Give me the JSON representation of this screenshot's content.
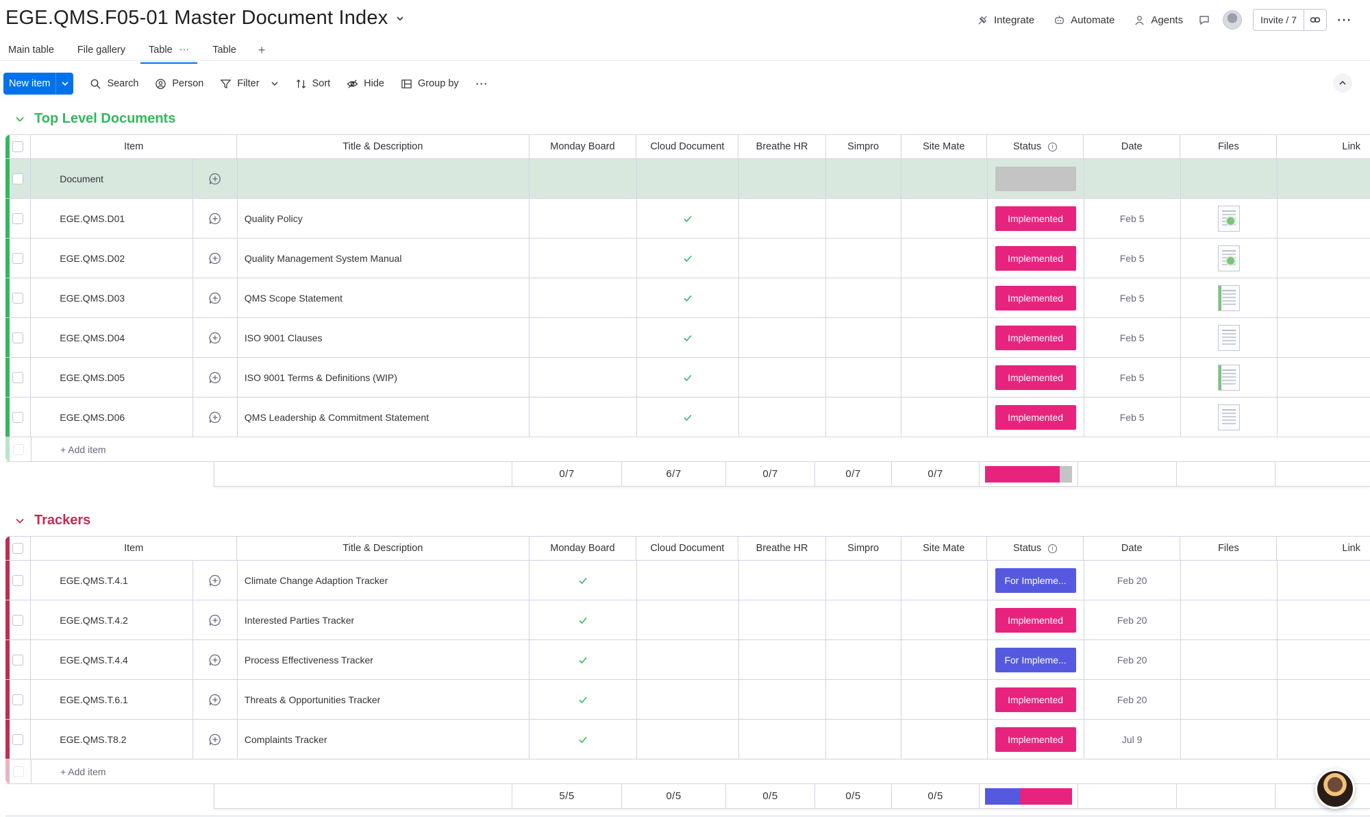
{
  "board": {
    "title": "EGE.QMS.F05-01 Master Document Index"
  },
  "top_actions": {
    "integrate": "Integrate",
    "automate": "Automate",
    "agents": "Agents",
    "invite": "Invite / 7"
  },
  "tabs": [
    {
      "label": "Main table"
    },
    {
      "label": "File gallery"
    },
    {
      "label": "Table",
      "active": true
    },
    {
      "label": "Table"
    }
  ],
  "toolbar": {
    "new_item": "New item",
    "search": "Search",
    "person": "Person",
    "filter": "Filter",
    "sort": "Sort",
    "hide": "Hide",
    "group_by": "Group by"
  },
  "columns": [
    "Item",
    "Title & Description",
    "Monday Board",
    "Cloud Document",
    "Breathe HR",
    "Simpro",
    "Site Mate",
    "Status",
    "Date",
    "Files",
    "Link"
  ],
  "colors": {
    "accent": "#0073ea",
    "group1": "#33b75d",
    "group2": "#c22c51",
    "implemented": "#e8237d",
    "for_implementation": "#5559df",
    "empty_status": "#c4c4c4",
    "check": "#33b75d",
    "selected_row": "#d9e8de"
  },
  "groups": [
    {
      "title": "Top Level Documents",
      "color": "#33b75d",
      "add_item": "+ Add item",
      "rows": [
        {
          "item": "Document",
          "title": "",
          "monday": false,
          "cloud": false,
          "status": "",
          "date": "",
          "file": ""
        },
        {
          "item": "EGE.QMS.D01",
          "title": "Quality Policy",
          "monday": false,
          "cloud": true,
          "status": "Implemented",
          "date": "Feb 5",
          "file": "green"
        },
        {
          "item": "EGE.QMS.D02",
          "title": "Quality Management System Manual",
          "monday": false,
          "cloud": true,
          "status": "Implemented",
          "date": "Feb 5",
          "file": "green"
        },
        {
          "item": "EGE.QMS.D03",
          "title": "QMS Scope Statement",
          "monday": false,
          "cloud": true,
          "status": "Implemented",
          "date": "Feb 5",
          "file": "side"
        },
        {
          "item": "EGE.QMS.D04",
          "title": "ISO 9001 Clauses",
          "monday": false,
          "cloud": true,
          "status": "Implemented",
          "date": "Feb 5",
          "file": "plain"
        },
        {
          "item": "EGE.QMS.D05",
          "title": "ISO 9001 Terms & Definitions (WIP)",
          "monday": false,
          "cloud": true,
          "status": "Implemented",
          "date": "Feb 5",
          "file": "side"
        },
        {
          "item": "EGE.QMS.D06",
          "title": "QMS Leadership & Commitment Statement",
          "monday": false,
          "cloud": true,
          "status": "Implemented",
          "date": "Feb 5",
          "file": "plain"
        }
      ],
      "summary": {
        "monday": "0/7",
        "cloud": "6/7",
        "breathe": "0/7",
        "simpro": "0/7",
        "sitemate": "0/7",
        "status_parts": [
          {
            "color": "#e8237d",
            "share": 0.857
          },
          {
            "color": "#c4c4c4",
            "share": 0.143
          }
        ]
      }
    },
    {
      "title": "Trackers",
      "color": "#c22c51",
      "add_item": "+ Add item",
      "rows": [
        {
          "item": "EGE.QMS.T.4.1",
          "title": "Climate Change Adaption Tracker",
          "monday": true,
          "cloud": false,
          "status": "For Impleme...",
          "date": "Feb 20",
          "file": ""
        },
        {
          "item": "EGE.QMS.T.4.2",
          "title": "Interested Parties Tracker",
          "monday": true,
          "cloud": false,
          "status": "Implemented",
          "date": "Feb 20",
          "file": ""
        },
        {
          "item": "EGE.QMS.T.4.4",
          "title": "Process Effectiveness Tracker",
          "monday": true,
          "cloud": false,
          "status": "For Impleme...",
          "date": "Feb 20",
          "file": ""
        },
        {
          "item": "EGE.QMS.T.6.1",
          "title": "Threats & Opportunities Tracker",
          "monday": true,
          "cloud": false,
          "status": "Implemented",
          "date": "Feb 20",
          "file": ""
        },
        {
          "item": "EGE.QMS.T8.2",
          "title": "Complaints Tracker",
          "monday": true,
          "cloud": false,
          "status": "Implemented",
          "date": "Jul 9",
          "file": ""
        }
      ],
      "summary": {
        "monday": "5/5",
        "cloud": "0/5",
        "breathe": "0/5",
        "simpro": "0/5",
        "sitemate": "0/5",
        "status_parts": [
          {
            "color": "#5559df",
            "share": 0.4
          },
          {
            "color": "#e8237d",
            "share": 0.6
          }
        ]
      }
    }
  ]
}
